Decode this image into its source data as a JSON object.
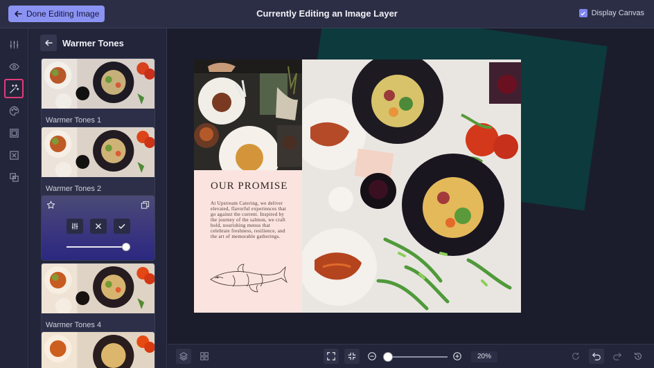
{
  "topbar": {
    "done_label": "Done Editing Image",
    "title": "Currently Editing an Image Layer",
    "display_canvas_label": "Display Canvas",
    "display_canvas_checked": true
  },
  "rail": {
    "items": [
      {
        "name": "adjustments-icon"
      },
      {
        "name": "visibility-icon"
      },
      {
        "name": "magic-effects-icon",
        "active": true
      },
      {
        "name": "palette-icon"
      },
      {
        "name": "frame-icon"
      },
      {
        "name": "crop-icon"
      },
      {
        "name": "layers-copy-icon"
      }
    ]
  },
  "panel": {
    "title": "Warmer Tones",
    "presets": [
      {
        "label": "Warmer Tones 1"
      },
      {
        "label": "Warmer Tones 2"
      },
      {
        "label": "",
        "active": true,
        "intensity": 1.0
      },
      {
        "label": "Warmer Tones 4"
      },
      {
        "label": ""
      }
    ]
  },
  "canvas": {
    "promise_title": "OUR PROMISE",
    "promise_body": "At Upstream Catering, we deliver elevated, flavorful experiences that go against the current. Inspired by the journey of the salmon, we craft bold, nourishing menus that celebrate freshness, resilience, and the art of memorable gatherings."
  },
  "bottombar": {
    "zoom_value": "20%",
    "zoom_level": 0.2
  },
  "colors": {
    "accent": "#8b93f2",
    "active_highlight": "#e23a7b",
    "canvas_teal": "#0d3a3d",
    "canvas_pink": "#fbe3df"
  }
}
